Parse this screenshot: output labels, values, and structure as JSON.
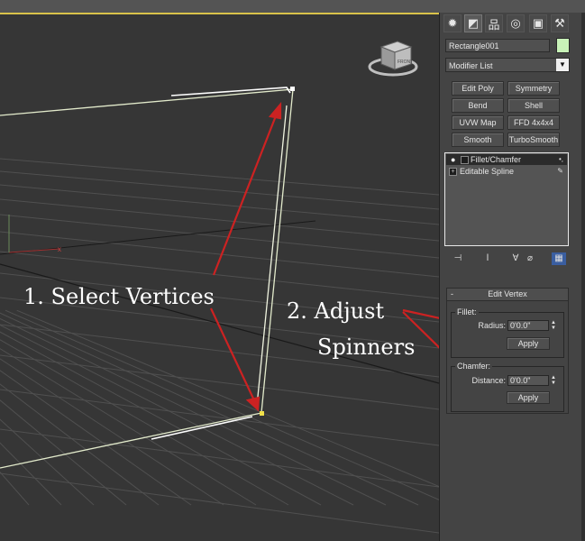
{
  "panel": {
    "tabs": [
      {
        "name": "create",
        "glyph": "✹"
      },
      {
        "name": "modify",
        "glyph": "◩"
      },
      {
        "name": "hierarchy",
        "glyph": "品"
      },
      {
        "name": "motion",
        "glyph": "◎"
      },
      {
        "name": "display",
        "glyph": "▣"
      },
      {
        "name": "utilities",
        "glyph": "⚒"
      }
    ],
    "object_name": "Rectangle001",
    "object_color": "#c8f2b8",
    "modifier_list": "Modifier List",
    "modifier_list_arrow": "▼",
    "quick_buttons": [
      "Edit Poly",
      "Symmetry",
      "Bend",
      "Shell",
      "UVW Map",
      "FFD 4x4x4",
      "Smooth",
      "TurboSmooth"
    ],
    "stack": [
      {
        "label": "Fillet/Chamfer",
        "box": "",
        "bulb": "💡",
        "selected": true
      },
      {
        "label": "Editable Spline",
        "box": "+",
        "bulb": "",
        "selected": false
      }
    ],
    "stack_tools": [
      "⊣",
      "Ⅰ",
      "∀",
      "⌀",
      "▦"
    ],
    "rollout": {
      "collapse": "-",
      "title": "Edit Vertex",
      "fillet": {
        "group": "Fillet:",
        "label": "Radius:",
        "value": "0'0.0\"",
        "apply": "Apply"
      },
      "chamfer": {
        "group": "Chamfer:",
        "label": "Distance:",
        "value": "0'0.0\"",
        "apply": "Apply"
      }
    }
  },
  "viewport": {
    "viewcube_text": "FRONT",
    "annotations": {
      "step1": "1. Select Vertices",
      "step2_line1": "2. Adjust",
      "step2_line2": "Spinners"
    },
    "arrow_color": "#cc2222",
    "spline_color": "#e2eacb"
  }
}
